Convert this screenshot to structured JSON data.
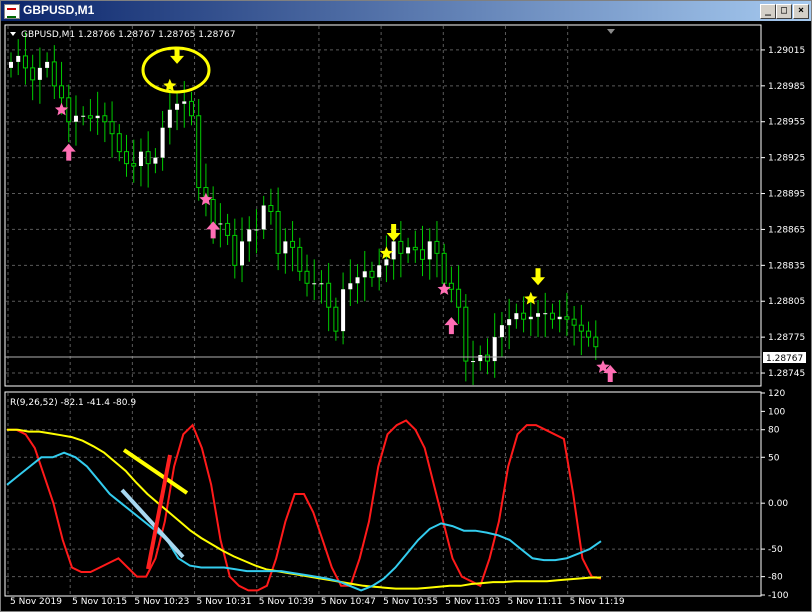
{
  "window": {
    "title": "GBPUSD,M1",
    "buttons": [
      "_",
      "□",
      "×"
    ]
  },
  "price_panel": {
    "header": "GBPUSD,M1  1.28766 1.28767 1.28765 1.28767",
    "current_price": "1.28767",
    "grid": true
  },
  "indicator_panel": {
    "header": "R(9,26,52) -82.1 -41.4 -80.9"
  },
  "colors": {
    "background": "#000000",
    "grid": "#5a5a5a",
    "bull_candle": "#ffffff",
    "wick": "#00cc00",
    "star_sell": "#ffff00",
    "star_buy": "#ff6eb4",
    "arrow_sell": "#ffff00",
    "arrow_buy": "#ff6eb4",
    "series_red": "#ff1a1a",
    "series_yellow": "#ffff00",
    "series_cyan": "#33ccee"
  },
  "chart_data": [
    {
      "type": "candlestick",
      "ylim": [
        1.28735,
        1.29035
      ],
      "y_ticks": [
        "1.29015",
        "1.28985",
        "1.28955",
        "1.28925",
        "1.28895",
        "1.28865",
        "1.28835",
        "1.28805",
        "1.28775",
        "1.28745"
      ],
      "x_ticks": [
        "5 Nov 2019",
        "5 Nov 10:15",
        "5 Nov 10:23",
        "5 Nov 10:31",
        "5 Nov 10:39",
        "5 Nov 10:47",
        "5 Nov 10:55",
        "5 Nov 11:03",
        "5 Nov 11:11",
        "5 Nov 11:19"
      ],
      "close_series": [
        1.29005,
        1.2901,
        1.29,
        1.2899,
        1.29,
        1.29005,
        1.28985,
        1.28975,
        1.28955,
        1.2896,
        1.2896,
        1.28958,
        1.2896,
        1.28955,
        1.28945,
        1.2893,
        1.2892,
        1.28918,
        1.2893,
        1.2892,
        1.28925,
        1.2895,
        1.28965,
        1.2897,
        1.28972,
        1.2896,
        1.289,
        1.2889,
        1.2887,
        1.2887,
        1.2886,
        1.28835,
        1.28855,
        1.28865,
        1.28865,
        1.28885,
        1.2888,
        1.28845,
        1.28855,
        1.2885,
        1.2883,
        1.2882,
        1.2882,
        1.2882,
        1.288,
        1.2878,
        1.28815,
        1.2882,
        1.28825,
        1.2883,
        1.28825,
        1.28835,
        1.2884,
        1.28855,
        1.28845,
        1.2885,
        1.28848,
        1.2884,
        1.28855,
        1.28845,
        1.2882,
        1.28815,
        1.288,
        1.28755,
        1.28755,
        1.2876,
        1.28755,
        1.28775,
        1.28785,
        1.2879,
        1.28795,
        1.2879,
        1.28792,
        1.28795,
        1.28795,
        1.2879,
        1.28792,
        1.2879,
        1.28785,
        1.2878,
        1.28775,
        1.28767
      ],
      "markers": [
        {
          "kind": "sell_star",
          "index": 22,
          "price": 1.28985
        },
        {
          "kind": "sell_arrow",
          "index": 23,
          "price": 1.2901,
          "circled": true
        },
        {
          "kind": "buy_star",
          "index": 7,
          "price": 1.28965
        },
        {
          "kind": "buy_arrow",
          "index": 8,
          "price": 1.2893
        },
        {
          "kind": "buy_star",
          "index": 27,
          "price": 1.2889
        },
        {
          "kind": "buy_arrow",
          "index": 28,
          "price": 1.28865
        },
        {
          "kind": "sell_star",
          "index": 52,
          "price": 1.28845
        },
        {
          "kind": "sell_arrow",
          "index": 53,
          "price": 1.28862
        },
        {
          "kind": "buy_star",
          "index": 60,
          "price": 1.28815
        },
        {
          "kind": "buy_arrow",
          "index": 61,
          "price": 1.28785
        },
        {
          "kind": "sell_star",
          "index": 72,
          "price": 1.28807
        },
        {
          "kind": "sell_arrow",
          "index": 73,
          "price": 1.28825
        },
        {
          "kind": "buy_star",
          "index": 82,
          "price": 1.2875
        },
        {
          "kind": "buy_arrow",
          "index": 83,
          "price": 1.28745
        }
      ]
    },
    {
      "type": "line",
      "ylim": [
        -100,
        120
      ],
      "y_ticks": [
        "120",
        "100",
        "80",
        "50",
        "0.00",
        "-50",
        "-80",
        "-100"
      ],
      "series": [
        {
          "color": "#ff1a1a",
          "values": [
            80,
            80,
            75,
            60,
            30,
            0,
            -40,
            -70,
            -75,
            -75,
            -70,
            -65,
            -60,
            -70,
            -80,
            -80,
            -60,
            -20,
            40,
            75,
            85,
            60,
            20,
            -40,
            -80,
            -90,
            -95,
            -95,
            -90,
            -60,
            -20,
            10,
            10,
            -10,
            -40,
            -70,
            -90,
            -90,
            -60,
            -20,
            40,
            75,
            85,
            90,
            80,
            60,
            20,
            -20,
            -60,
            -80,
            -85,
            -90,
            -60,
            -20,
            40,
            75,
            85,
            85,
            80,
            75,
            70,
            10,
            -60,
            -80,
            -82.1
          ]
        },
        {
          "color": "#ffff00",
          "values": [
            80,
            80,
            78,
            78,
            76,
            74,
            72,
            68,
            62,
            55,
            45,
            35,
            22,
            10,
            0,
            -10,
            -20,
            -30,
            -38,
            -45,
            -52,
            -58,
            -63,
            -68,
            -72,
            -74,
            -76,
            -78,
            -80,
            -82,
            -84,
            -86,
            -88,
            -90,
            -91,
            -92,
            -93,
            -93,
            -93,
            -92,
            -91,
            -90,
            -90,
            -88,
            -87,
            -86,
            -86,
            -85,
            -85,
            -85,
            -85,
            -84,
            -83,
            -82,
            -81,
            -80.9
          ]
        },
        {
          "color": "#33ccee",
          "values": [
            20,
            30,
            40,
            50,
            50,
            55,
            50,
            40,
            25,
            10,
            0,
            -10,
            -20,
            -30,
            -40,
            -60,
            -68,
            -70,
            -70,
            -70,
            -72,
            -74,
            -74,
            -74,
            -74,
            -76,
            -78,
            -80,
            -82,
            -85,
            -90,
            -95,
            -90,
            -82,
            -70,
            -55,
            -40,
            -28,
            -22,
            -25,
            -30,
            -30,
            -32,
            -35,
            -40,
            -50,
            -60,
            -62,
            -62,
            -60,
            -55,
            -50,
            -41.4
          ]
        }
      ]
    }
  ]
}
